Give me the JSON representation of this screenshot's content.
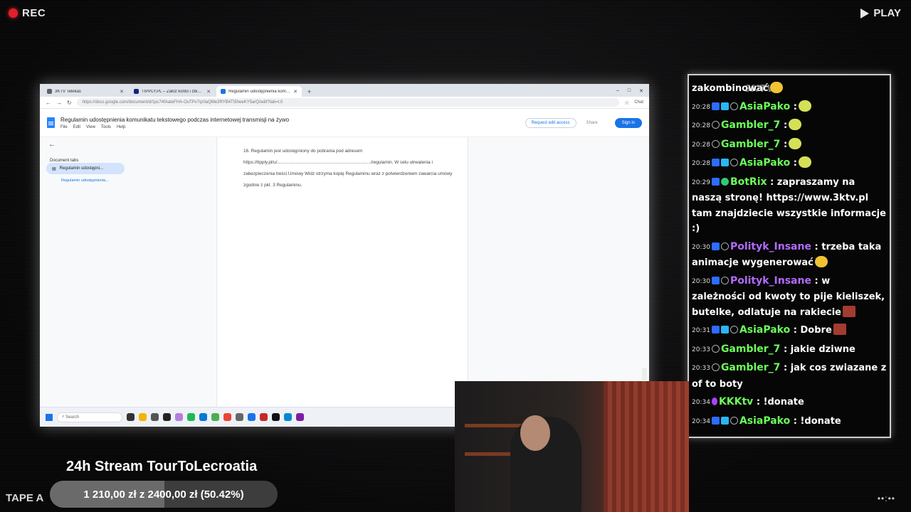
{
  "overlay": {
    "rec": "REC",
    "play": "PLAY",
    "tape": "TAPE A",
    "corner_glyph": "••:••"
  },
  "browser": {
    "tabs": [
      {
        "label": "3KTV Telekas"
      },
      {
        "label": "TIPPLY.PL – Zaloz konto i zbieraj..."
      },
      {
        "label": "Regulamin udostępnienia komuni..."
      }
    ],
    "url": "https://docs.google.com/document/d/1pc74fAateFHA-OuTPv7qr0aQMe3RYB4TI5heeKY5arQ/edit?tab=t.0",
    "chat_label": "Chat"
  },
  "doc": {
    "title": "Regulamin udostępnienia komunikatu tekstowego podczas internetowej transmisji na żywo",
    "menu": [
      "File",
      "Edit",
      "View",
      "Tools",
      "Help"
    ],
    "request_edit": "Request edit access",
    "share": "Share",
    "sign_in": "Sign in",
    "tabs_heading": "Document tabs",
    "tab_active": "Regulamin udostępni...",
    "tab_sub": "Regulamin udostępnienia...",
    "paragraph": "16. Regulamin jest udostępniony do pobrania pod adresem https://tipply.pl/u/........................................................................../regulamin. W celu utrwalenia i zabezpieczenia treści Umowy Widz otrzyma kopię Regulaminu wraz z potwierdzeniem zawarcia umowy zgodnie z pkt. 3 Regulaminu."
  },
  "taskbar": {
    "search": "Search"
  },
  "chat": {
    "logo": "3KTV",
    "messages": [
      {
        "time": "",
        "user": "",
        "text": "zakombinować",
        "badges": [],
        "emoji": "yellow"
      },
      {
        "time": "20:28",
        "user": "AsiaPako",
        "text": ":",
        "badges": [
          "blue",
          "cyan",
          "gray"
        ],
        "emoji": "green",
        "color": "green"
      },
      {
        "time": "20:28",
        "user": "Gambler_7",
        "text": ":",
        "badges": [
          "gray"
        ],
        "emoji": "green",
        "color": "green"
      },
      {
        "time": "20:28",
        "user": "Gambler_7",
        "text": ":",
        "badges": [
          "gray"
        ],
        "emoji": "green",
        "color": "green"
      },
      {
        "time": "20:28",
        "user": "AsiaPako",
        "text": ":",
        "badges": [
          "blue",
          "cyan",
          "gray"
        ],
        "emoji": "green",
        "color": "green"
      },
      {
        "time": "20:29",
        "user": "BotRix",
        "text": ": zapraszamy na naszą stronę! https://www.3ktv.pl tam znajdziecie wszystkie informacje :)",
        "badges": [
          "blue",
          "green"
        ],
        "emoji": "",
        "color": "green"
      },
      {
        "time": "20:30",
        "user": "Polityk_Insane",
        "text": ": trzeba taka animacje wygenerować",
        "badges": [
          "blue",
          "gray"
        ],
        "emoji": "yellow",
        "color": "purple"
      },
      {
        "time": "20:30",
        "user": "Polityk_Insane",
        "text": ": w zależności od kwoty to pije kieliszek, butelke, odlatuje na rakiecie",
        "badges": [
          "blue",
          "gray"
        ],
        "emoji": "red",
        "color": "purple"
      },
      {
        "time": "20:31",
        "user": "AsiaPako",
        "text": ": Dobre",
        "badges": [
          "blue",
          "cyan",
          "gray"
        ],
        "emoji": "red",
        "color": "green"
      },
      {
        "time": "20:33",
        "user": "Gambler_7",
        "text": ": jakie dziwne",
        "badges": [
          "gray"
        ],
        "emoji": "",
        "color": "green"
      },
      {
        "time": "20:33",
        "user": "Gambler_7",
        "text": ": jak cos zwiazane z of to boty",
        "badges": [
          "gray"
        ],
        "emoji": "",
        "color": "green"
      },
      {
        "time": "20:34",
        "user": "KKKtv",
        "text": ": !donate",
        "badges": [
          "purple"
        ],
        "emoji": "",
        "color": "green"
      },
      {
        "time": "20:34",
        "user": "AsiaPako",
        "text": ": !donate",
        "badges": [
          "blue",
          "cyan",
          "gray"
        ],
        "emoji": "",
        "color": "green"
      }
    ]
  },
  "stream": {
    "title": "24h Stream TourToLecroatia",
    "goal_text": "1 210,00 zł z 2400,00 zł (50.42%)",
    "goal_fraction": 0.5042
  }
}
